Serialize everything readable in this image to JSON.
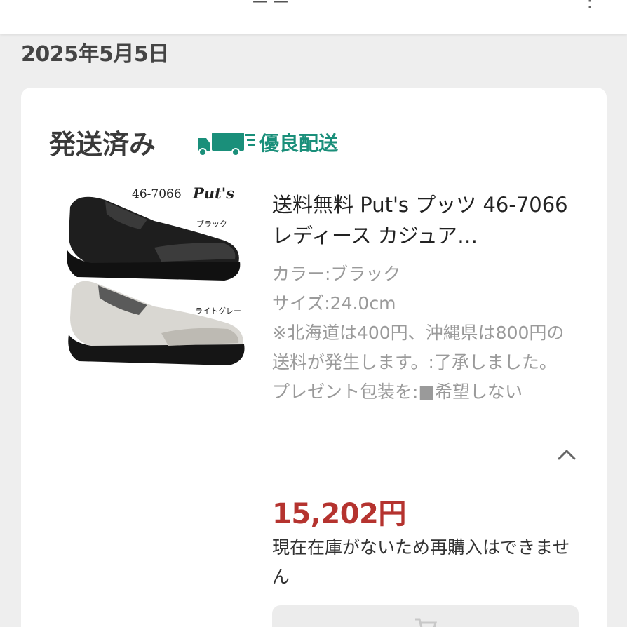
{
  "order": {
    "date": "2025年5月5日"
  },
  "shipment": {
    "status": "発送済み",
    "badge_label": "優良配送",
    "badge_icon": "truck-icon",
    "badge_color": "#1a8f7a"
  },
  "product": {
    "title": "送料無料 Put's プッツ 46-7066 レディース カジュア…",
    "image_texts": {
      "model": "46-7066",
      "brand": "Put's",
      "color_black": "ブラック",
      "color_light_gray": "ライトグレー"
    },
    "options": [
      "カラー:ブラック",
      "サイズ:24.0cm",
      "※北海道は400円、沖縄県は800円の送料が発生します。:了承しました。",
      "プレゼント包装を:■希望しない"
    ],
    "price": "15,202円",
    "price_color": "#b5332f",
    "stock_note": "現在在庫がないため再購入はできません"
  },
  "actions": {
    "collapse_icon": "chevron-up-icon",
    "repurchase_icon": "cart-icon"
  }
}
